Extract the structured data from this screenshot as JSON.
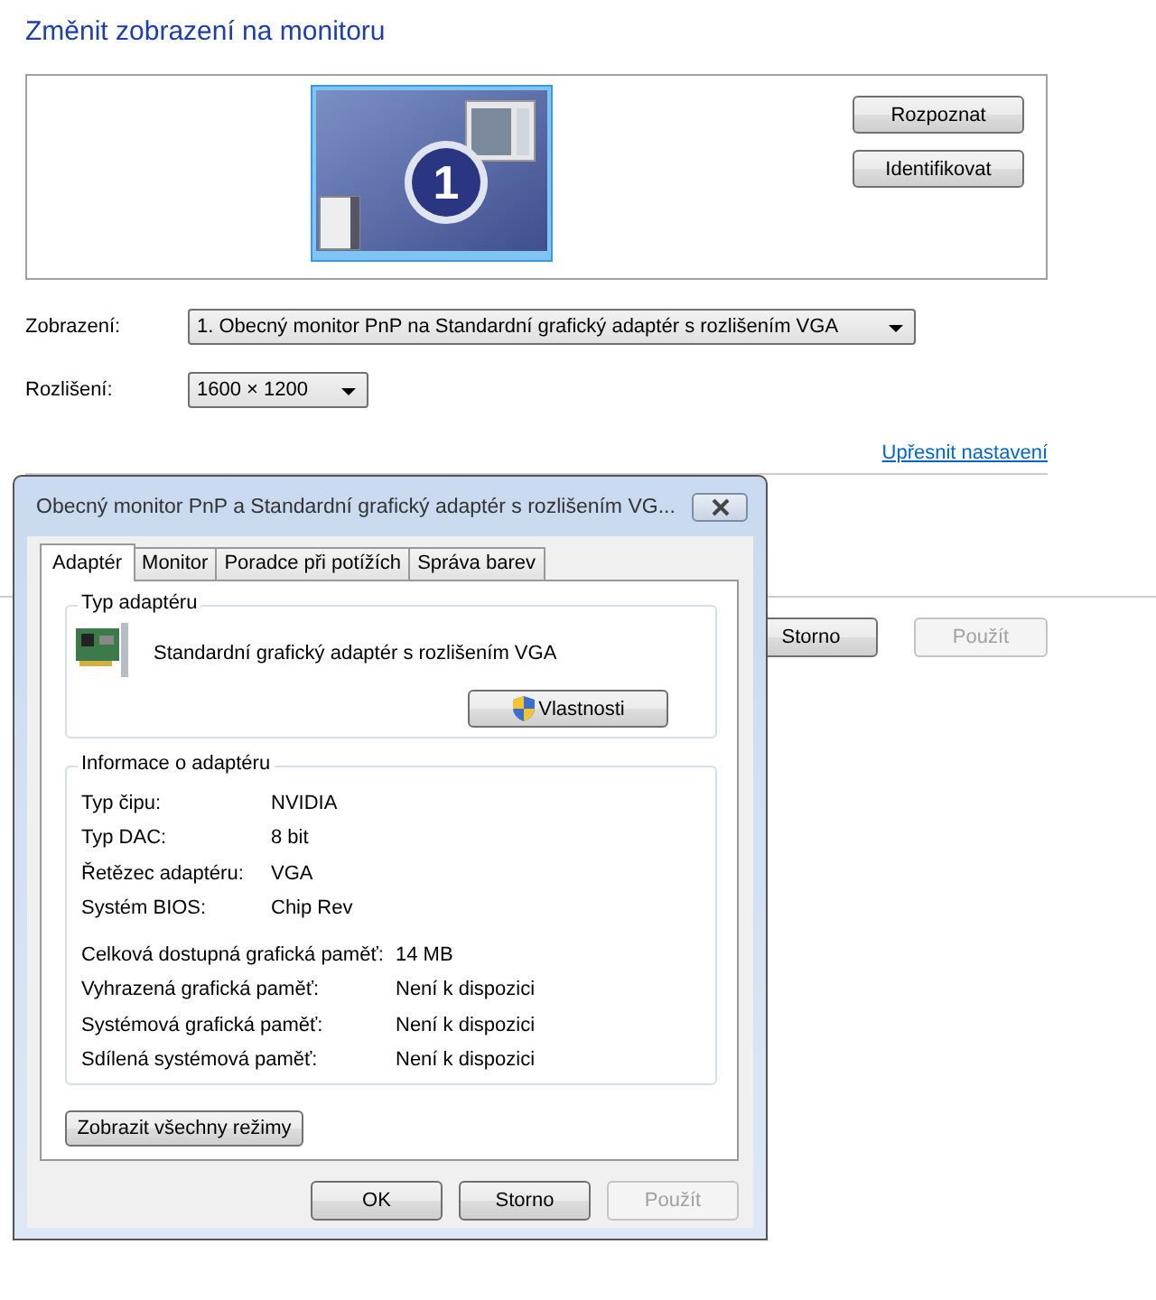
{
  "page": {
    "title": "Změnit zobrazení na monitoru",
    "monitor_number": "1",
    "side_buttons": [
      {
        "label": "Rozpoznat",
        "disabled": false
      },
      {
        "label": "Identifikovat",
        "disabled": false
      }
    ],
    "fields": [
      {
        "label": "Zobrazení:",
        "value": "1. Obecný monitor PnP na Standardní grafický adaptér s rozlišením VGA",
        "kind": "wide"
      },
      {
        "label": "Rozlišení:",
        "value": "1600 × 1200",
        "kind": "narrow"
      }
    ],
    "advanced_link": "Upřesnit nastavení",
    "footer_buttons": [
      {
        "label": "Storno",
        "disabled": false
      },
      {
        "label": "Použít",
        "disabled": true
      }
    ]
  },
  "dialog": {
    "title": "Obecný monitor PnP a Standardní grafický adaptér s rozlišením VG...",
    "tabs": [
      {
        "label": "Adaptér",
        "selected": true
      },
      {
        "label": "Monitor",
        "selected": false
      },
      {
        "label": "Poradce při potížích",
        "selected": false
      },
      {
        "label": "Správa barev",
        "selected": false
      }
    ],
    "adapter_type": {
      "legend": "Typ adaptéru",
      "name": "Standardní grafický adaptér s rozlišením VGA",
      "button": "Vlastnosti"
    },
    "info": {
      "legend": "Informace o adaptéru",
      "rows": [
        {
          "label": "Typ čipu:",
          "value": "NVIDIA"
        },
        {
          "label": "Typ DAC:",
          "value": "8 bit"
        },
        {
          "label": "Řetězec adaptéru:",
          "value": "VGA"
        },
        {
          "label": "Systém BIOS:",
          "value": "Chip Rev"
        }
      ],
      "memory_rows": [
        {
          "label": "Celková dostupná grafická paměť:",
          "value": "14 MB"
        },
        {
          "label": "Vyhrazená grafická paměť:",
          "value": "Není k dispozici"
        },
        {
          "label": "Systémová grafická paměť:",
          "value": "Není k dispozici"
        },
        {
          "label": "Sdílená systémová paměť:",
          "value": "Není k dispozici"
        }
      ]
    },
    "modes_button": "Zobrazit všechny režimy",
    "buttons": [
      {
        "label": "OK",
        "disabled": false
      },
      {
        "label": "Storno",
        "disabled": false
      },
      {
        "label": "Použít",
        "disabled": true
      }
    ]
  }
}
